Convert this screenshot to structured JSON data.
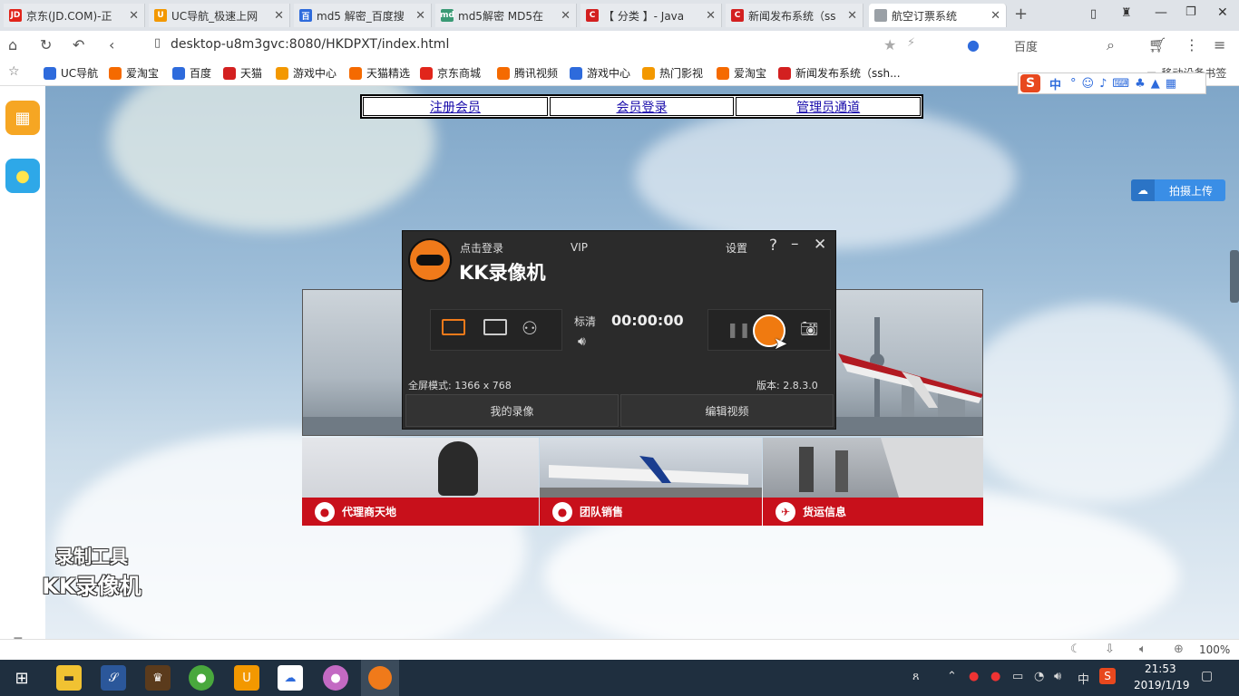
{
  "tabs": [
    {
      "label": "京东(JD.COM)-正",
      "fav": "JD",
      "color": "#e1251b"
    },
    {
      "label": "UC导航_极速上网",
      "fav": "U",
      "color": "#f39800"
    },
    {
      "label": "md5 解密_百度搜",
      "fav": "百",
      "color": "#2e6bdc"
    },
    {
      "label": "md5解密 MD5在",
      "fav": "md",
      "color": "#3a9a75"
    },
    {
      "label": "【 分类 】- Java",
      "fav": "C",
      "color": "#d32020"
    },
    {
      "label": "新闻发布系统（ss",
      "fav": "C",
      "color": "#d32020"
    },
    {
      "label": "航空订票系统",
      "fav": "",
      "color": "#9aa0a6"
    }
  ],
  "address": {
    "url": "desktop-u8m3gvc:8080/HKDPXT/index.html",
    "search_engine": "百度"
  },
  "bookmarks": [
    {
      "label": "UC导航",
      "color": "#2e6bdc"
    },
    {
      "label": "爱淘宝",
      "color": "#f56a00"
    },
    {
      "label": "百度",
      "color": "#2e6bdc"
    },
    {
      "label": "天猫",
      "color": "#d32020"
    },
    {
      "label": "游戏中心",
      "color": "#f39800"
    },
    {
      "label": "天猫精选",
      "color": "#f56a00"
    },
    {
      "label": "京东商城",
      "color": "#e1251b"
    },
    {
      "label": "腾讯视频",
      "color": "#f56a00"
    },
    {
      "label": "游戏中心",
      "color": "#2e6bdc"
    },
    {
      "label": "热门影视",
      "color": "#f39800"
    },
    {
      "label": "爱淘宝",
      "color": "#f56a00"
    },
    {
      "label": "新闻发布系统（ssh...",
      "color": "#d32020"
    }
  ],
  "bookmarks_right": "移动设备书签",
  "nav_links": [
    "注册会员",
    "会员登录",
    "管理员通道"
  ],
  "upload_button": "拍摄上传",
  "recorder": {
    "login": "点击登录",
    "vip": "VIP",
    "settings": "设置",
    "help": "?",
    "brand": "KK录像机",
    "quality": "标清",
    "timer": "00:00:00",
    "mode_label": "全屏模式: 1366 x 768",
    "version": "版本: 2.8.3.0",
    "my_videos": "我的录像",
    "edit_video": "编辑视频"
  },
  "banners": [
    "代理商天地",
    "团队销售",
    "货运信息"
  ],
  "watermark": {
    "line1": "录制工具",
    "line2": "KK录像机"
  },
  "status": {
    "zoom": "100%"
  },
  "taskbar": {
    "time": "21:53",
    "date": "2019/1/19",
    "ime": "中"
  }
}
